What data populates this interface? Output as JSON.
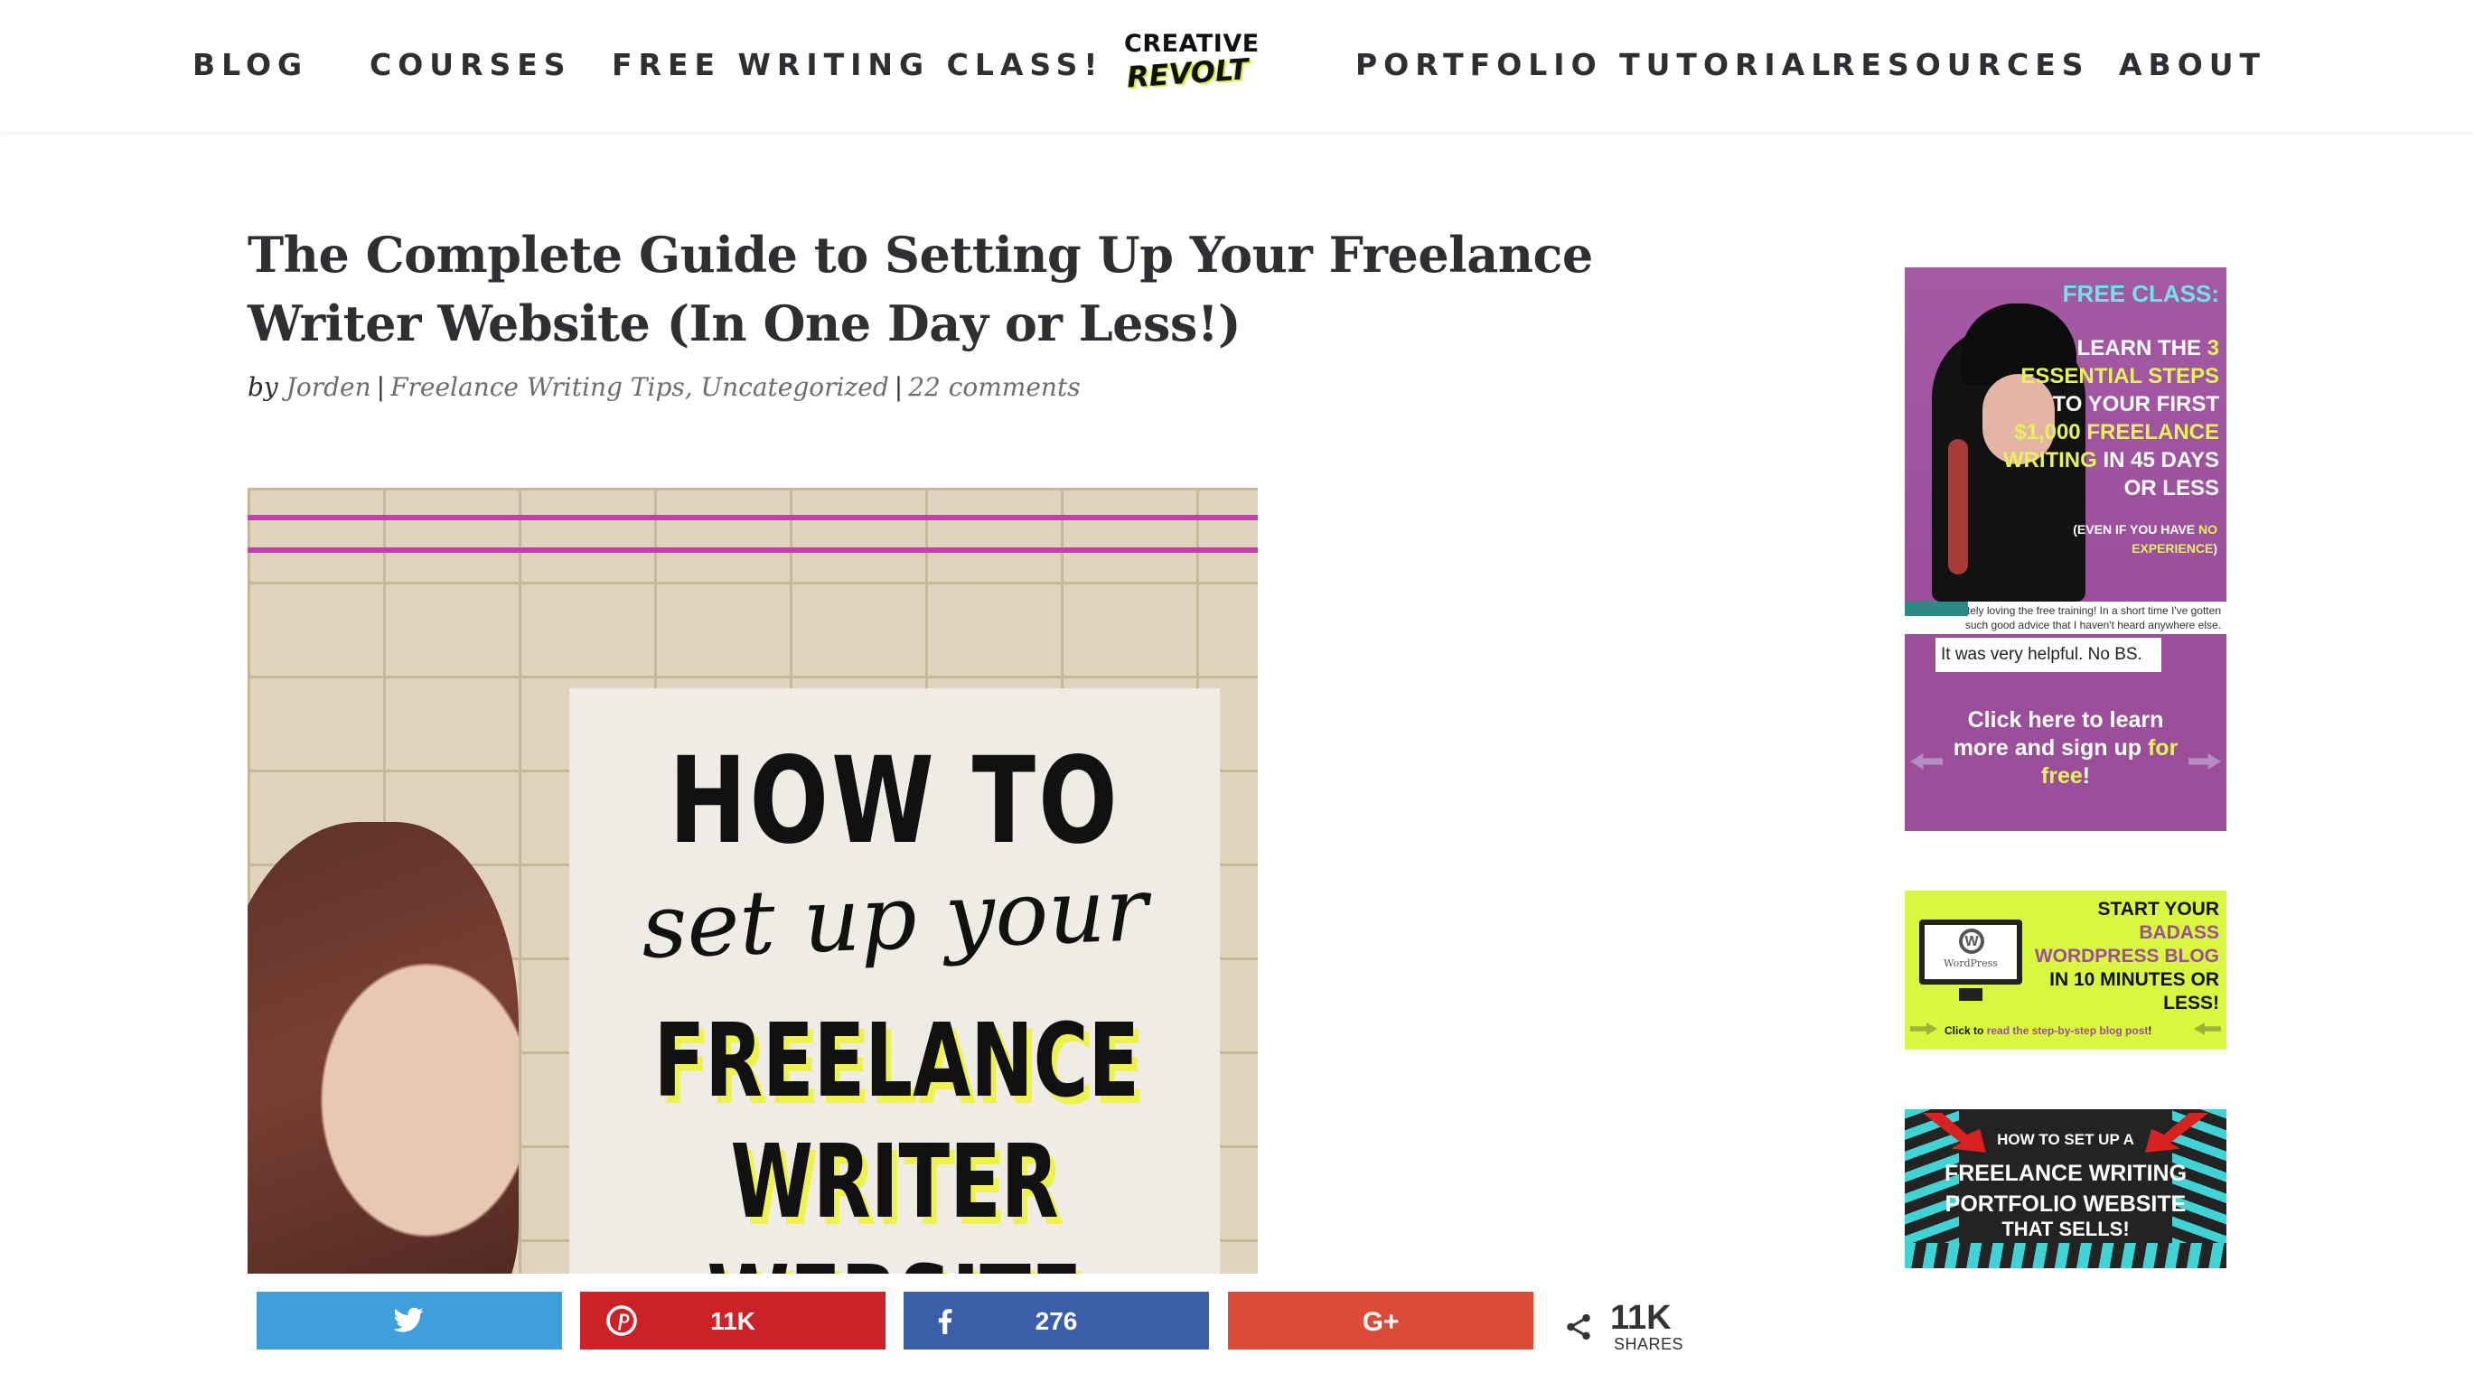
{
  "nav": {
    "left": [
      "BLOG",
      "COURSES",
      "FREE WRITING CLASS!"
    ],
    "right": [
      "PORTFOLIO TUTORIAL",
      "RESOURCES",
      "ABOUT"
    ],
    "logo_line1": "CREATIVE",
    "logo_line2": "REVOLT"
  },
  "post": {
    "title": "The Complete Guide to Setting Up Your Freelance Writer Website (In One Day or Less!)",
    "by": "by",
    "author": "Jorden",
    "category1": "Freelance Writing Tips",
    "category2": "Uncategorized",
    "comments": "22 comments"
  },
  "featured_image": {
    "line1": "HOW TO",
    "line2": "set up your",
    "line3": "FREELANCE",
    "line4": "WRITER",
    "line5": "WEBSITE"
  },
  "share": {
    "pinterest_count": "11K",
    "facebook_count": "276",
    "total": "11K",
    "total_label": "SHARES",
    "twitter_icon": "twitter-icon",
    "pinterest_icon": "pinterest-icon",
    "facebook_icon": "facebook-icon",
    "gplus_icon": "google-plus-icon",
    "gplus_label": "G+"
  },
  "sidebar": {
    "ad1": {
      "heading": "FREE CLASS:",
      "line1": "LEARN THE ",
      "hl1": "3 ESSENTIAL STEPS",
      "line2": " TO YOUR FIRST ",
      "hl2": "$1,000 FREELANCE WRITING",
      "line3": " IN 45 DAYS OR LESS",
      "note1": "(EVEN IF YOU HAVE ",
      "note_hl": "NO EXPERIENCE",
      "note2": ")",
      "quote1": "I'm definitely loving the free training! In a short time I've gotten such good advice that I haven't heard anywhere else.",
      "quote2": "It was very helpful. No BS.",
      "cta1": "Click here to learn more and sign up ",
      "cta_hl": "for free",
      "cta2": "!"
    },
    "ad2": {
      "line1": "START YOUR ",
      "hl": "BADASS WORDPRESS BLOG",
      "line2": " IN 10 MINUTES OR LESS!",
      "wp_mark": "W",
      "wp_text": "WordPress",
      "foot1": "Click to ",
      "foot_hl": "read the step-by-step blog post",
      "foot2": "!"
    },
    "ad3": {
      "small": "HOW TO SET UP A",
      "main1": "FREELANCE WRITING",
      "main2": "PORTFOLIO WEBSITE",
      "sub": "THAT SELLS!"
    }
  },
  "colors": {
    "twitter": "#3f9fdb",
    "pinterest": "#cc2127",
    "facebook": "#3b5ea8",
    "gplus": "#dc4a38",
    "ad_purple": "#9b4f9b",
    "ad_lime": "#d9f73e",
    "accent_yellow": "#e6f25a"
  }
}
